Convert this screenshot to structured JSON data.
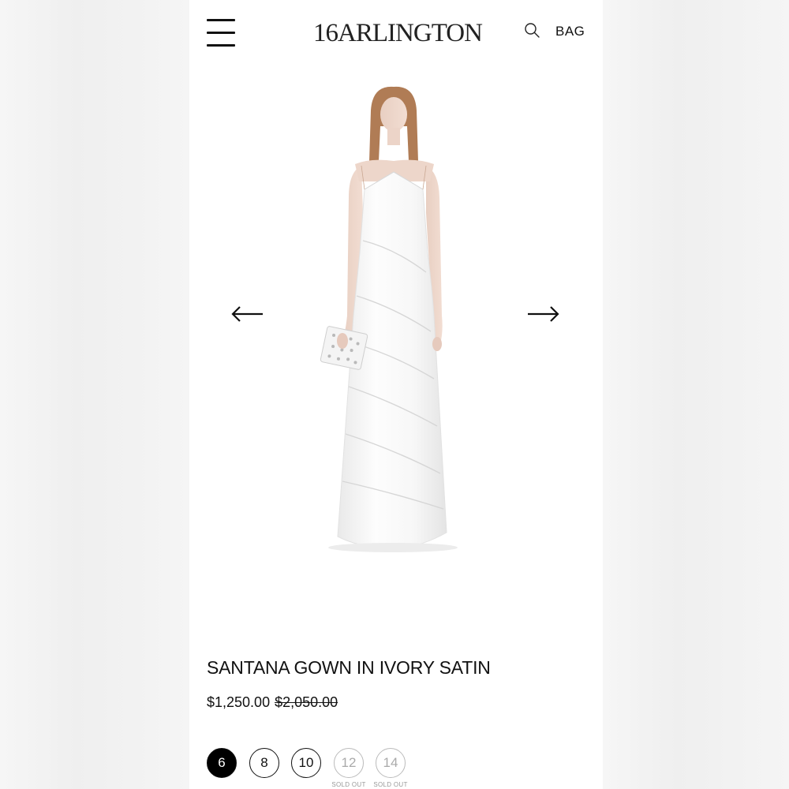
{
  "header": {
    "logo": "16ARLINGTON",
    "bag_label": "BAG",
    "icons": {
      "menu": "hamburger-menu-icon",
      "search": "search-icon"
    }
  },
  "carousel": {
    "prev_icon": "arrow-left-icon",
    "next_icon": "arrow-right-icon",
    "image": "model in long ivory satin halter gown holding white clutch"
  },
  "product": {
    "title": "SANTANA GOWN IN IVORY SATIN",
    "sale_price": "$1,250.00",
    "original_price": "$2,050.00",
    "sizes": [
      {
        "label": "6",
        "status": "selected"
      },
      {
        "label": "8",
        "status": "available"
      },
      {
        "label": "10",
        "status": "available"
      },
      {
        "label": "12",
        "status": "sold-out",
        "note": "SOLD OUT"
      },
      {
        "label": "14",
        "status": "sold-out",
        "note": "SOLD OUT"
      }
    ]
  },
  "colors": {
    "selected_size_bg": "#000000",
    "sold_out": "#aaaaaa",
    "page_bg": "#ffffff"
  }
}
